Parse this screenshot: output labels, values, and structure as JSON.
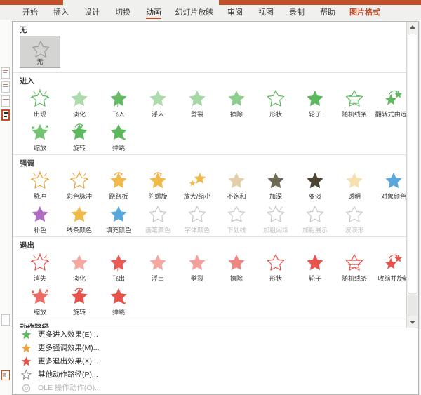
{
  "app": {
    "accent_color": "#c0502a",
    "panel_bg": "#ffffff"
  },
  "ribbon": {
    "tabs": [
      {
        "label": "开始",
        "state": "normal"
      },
      {
        "label": "插入",
        "state": "normal"
      },
      {
        "label": "设计",
        "state": "normal"
      },
      {
        "label": "切换",
        "state": "normal"
      },
      {
        "label": "动画",
        "state": "active"
      },
      {
        "label": "幻灯片放映",
        "state": "normal"
      },
      {
        "label": "审阅",
        "state": "normal"
      },
      {
        "label": "视图",
        "state": "normal"
      },
      {
        "label": "录制",
        "state": "normal"
      },
      {
        "label": "帮助",
        "state": "normal"
      },
      {
        "label": "图片格式",
        "state": "contextual"
      }
    ]
  },
  "gallery": {
    "groups": [
      {
        "id": "none",
        "title": "无",
        "kind": "none",
        "items": [
          {
            "label": "无",
            "icon": "star-outline-icon",
            "selected": true,
            "disabled": false
          }
        ]
      },
      {
        "id": "entrance",
        "title": "进入",
        "kind": "star",
        "color": "#5cb85c",
        "items": [
          {
            "label": "出现",
            "icon": "star-appear-icon",
            "disabled": false
          },
          {
            "label": "淡化",
            "icon": "star-fade-icon",
            "disabled": false
          },
          {
            "label": "飞入",
            "icon": "star-flyin-icon",
            "disabled": false
          },
          {
            "label": "浮入",
            "icon": "star-floatin-icon",
            "disabled": false
          },
          {
            "label": "劈裂",
            "icon": "star-split-icon",
            "disabled": false
          },
          {
            "label": "擦除",
            "icon": "star-wipe-icon",
            "disabled": false
          },
          {
            "label": "形状",
            "icon": "star-shape-icon",
            "disabled": false
          },
          {
            "label": "轮子",
            "icon": "star-wheel-icon",
            "disabled": false
          },
          {
            "label": "随机线条",
            "icon": "star-randombars-icon",
            "disabled": false
          },
          {
            "label": "翻转式由远...",
            "icon": "star-flipfar-icon",
            "disabled": false
          },
          {
            "label": "缩放",
            "icon": "star-zoom-icon",
            "disabled": false
          },
          {
            "label": "旋转",
            "icon": "star-spin-icon",
            "disabled": false
          },
          {
            "label": "弹跳",
            "icon": "star-bounce-icon",
            "disabled": false
          }
        ]
      },
      {
        "id": "emphasis",
        "title": "强调",
        "kind": "star",
        "color": "#e8a33d",
        "items": [
          {
            "label": "脉冲",
            "icon": "star-pulse-icon",
            "disabled": false,
            "fill": "#f0b94a"
          },
          {
            "label": "彩色脉冲",
            "icon": "star-colorpulse-icon",
            "disabled": false,
            "fill": "#f6d9a2"
          },
          {
            "label": "跷跷板",
            "icon": "star-teeter-icon",
            "disabled": false,
            "fill": "#f0b94a"
          },
          {
            "label": "陀螺旋",
            "icon": "star-spin-emph-icon",
            "disabled": false,
            "fill": "#f0b94a"
          },
          {
            "label": "放大/缩小",
            "icon": "star-growshrink-icon",
            "disabled": false,
            "fill": "#f0b94a"
          },
          {
            "label": "不饱和",
            "icon": "star-desaturate-icon",
            "disabled": false,
            "fill": "#e3cfa8"
          },
          {
            "label": "加深",
            "icon": "star-darken-icon",
            "disabled": false,
            "fill": "#6e6a55"
          },
          {
            "label": "变淡",
            "icon": "star-lighten-icon",
            "disabled": false,
            "fill": "#4a4430"
          },
          {
            "label": "透明",
            "icon": "star-transparent-icon",
            "disabled": false,
            "fill": "#f7dfae"
          },
          {
            "label": "对象颜色",
            "icon": "star-objectcolor-icon",
            "disabled": false,
            "fill": "#59a8dd"
          },
          {
            "label": "补色",
            "icon": "star-complement-icon",
            "disabled": false,
            "fill": "#b06cc0"
          },
          {
            "label": "线条颜色",
            "icon": "star-linecolor-icon",
            "disabled": false,
            "fill": "#f0b94a"
          },
          {
            "label": "填充颜色",
            "icon": "star-fillcolor-icon",
            "disabled": false,
            "fill": "#59a8dd"
          },
          {
            "label": "画笔颜色",
            "icon": "star-brushcolor-icon",
            "disabled": true
          },
          {
            "label": "字体颜色",
            "icon": "star-fontcolor-icon",
            "disabled": true
          },
          {
            "label": "下划线",
            "icon": "star-underline-icon",
            "disabled": true
          },
          {
            "label": "加粗闪烁",
            "icon": "star-boldflash-icon",
            "disabled": true
          },
          {
            "label": "加粗展示",
            "icon": "star-boldreveal-icon",
            "disabled": true
          },
          {
            "label": "波浪形",
            "icon": "star-wave-icon",
            "disabled": true
          }
        ]
      },
      {
        "id": "exit",
        "title": "退出",
        "kind": "star",
        "color": "#e8524a",
        "items": [
          {
            "label": "消失",
            "icon": "star-disappear-icon",
            "disabled": false
          },
          {
            "label": "淡化",
            "icon": "star-fadeout-icon",
            "disabled": false
          },
          {
            "label": "飞出",
            "icon": "star-flyout-icon",
            "disabled": false
          },
          {
            "label": "浮出",
            "icon": "star-floatout-icon",
            "disabled": false
          },
          {
            "label": "劈裂",
            "icon": "star-splitout-icon",
            "disabled": false
          },
          {
            "label": "擦除",
            "icon": "star-wipeout-icon",
            "disabled": false
          },
          {
            "label": "形状",
            "icon": "star-shapeout-icon",
            "disabled": false
          },
          {
            "label": "轮子",
            "icon": "star-wheelout-icon",
            "disabled": false
          },
          {
            "label": "随机线条",
            "icon": "star-randomout-icon",
            "disabled": false
          },
          {
            "label": "收缩并旋转",
            "icon": "star-shrinkturn-icon",
            "disabled": false
          },
          {
            "label": "缩放",
            "icon": "star-zoomout-icon",
            "disabled": false
          },
          {
            "label": "旋转",
            "icon": "star-spinout-icon",
            "disabled": false
          },
          {
            "label": "弹跳",
            "icon": "star-bounceout-icon",
            "disabled": false
          }
        ]
      },
      {
        "id": "motionpath",
        "title": "动作路径",
        "kind": "path",
        "start_color": "#3ea14a",
        "end_color": "#e8524a",
        "items": [
          {
            "label": "",
            "icon": "path-lines-icon"
          },
          {
            "label": "",
            "icon": "path-arcs-icon"
          },
          {
            "label": "",
            "icon": "path-turns-icon"
          },
          {
            "label": "",
            "icon": "path-shapes-icon"
          },
          {
            "label": "",
            "icon": "path-loops-icon"
          },
          {
            "label": "",
            "icon": "path-custom-icon"
          }
        ]
      }
    ]
  },
  "menu": {
    "items": [
      {
        "label": "更多进入效果(E)...",
        "icon": "star-green-icon",
        "accel": "E",
        "disabled": false
      },
      {
        "label": "更多强调效果(M)...",
        "icon": "star-orange-icon",
        "accel": "M",
        "disabled": false
      },
      {
        "label": "更多退出效果(X)...",
        "icon": "star-red-icon",
        "accel": "X",
        "disabled": false
      },
      {
        "label": "其他动作路径(P)...",
        "icon": "star-path-icon",
        "accel": "P",
        "disabled": false
      },
      {
        "label": "OLE 操作动作(O)...",
        "icon": "gear-icon",
        "accel": "O",
        "disabled": true
      }
    ]
  },
  "scrollbar": {
    "up_icon": "scroll-up-arrow-icon",
    "down_icon": "scroll-down-arrow-icon",
    "thumb_position_pct": 0,
    "thumb_size_pct": 88
  }
}
